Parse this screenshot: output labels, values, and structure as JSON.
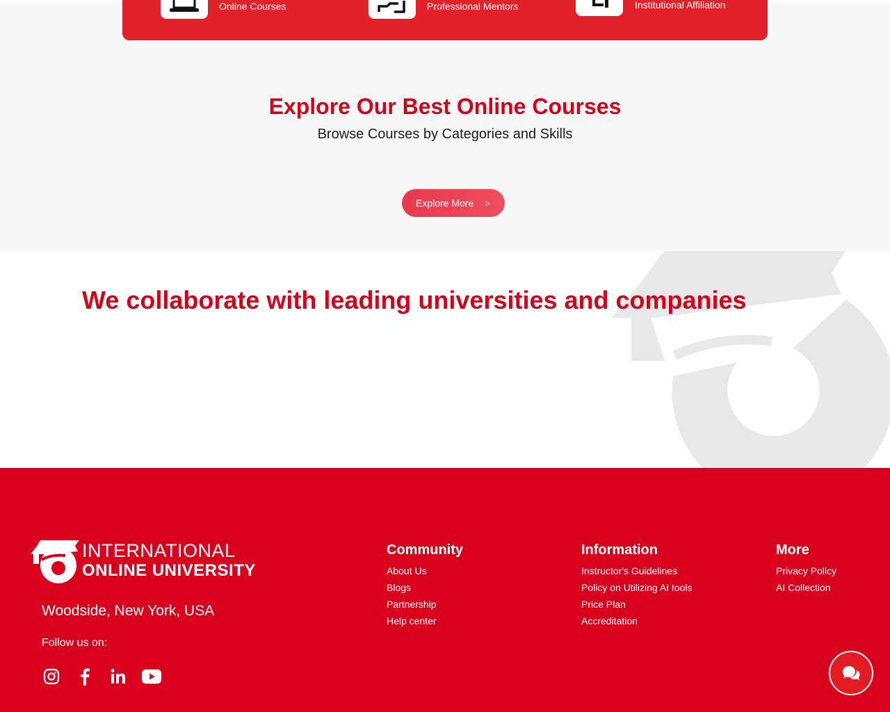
{
  "features": [
    {
      "label": "Online Courses",
      "icon": "laptop-icon"
    },
    {
      "label": "Professional Mentors",
      "icon": "mentor-icon"
    },
    {
      "label": "Institutional Affiliation",
      "icon": "institution-icon"
    }
  ],
  "explore": {
    "title": "Explore Our Best Online Courses",
    "subtitle": "Browse Courses by Categories and Skills",
    "button_label": "Explore More",
    "button_chevron": ">"
  },
  "collab": {
    "title": "We collaborate with leading universities and companies"
  },
  "footer": {
    "logo_line1": "INTERNATIONAL",
    "logo_line2": "ONLINE UNIVERSITY",
    "address": "Woodside, New York, USA",
    "follow_label": "Follow us on:",
    "socials": [
      "instagram-icon",
      "facebook-icon",
      "linkedin-icon",
      "youtube-icon"
    ],
    "columns": {
      "community": {
        "title": "Community",
        "links": [
          "About Us",
          "Blogs",
          "Partnership",
          "Help center"
        ]
      },
      "information": {
        "title": "Information",
        "links": [
          "Instructor's Guidelines",
          "Policy on Utilizing AI tools",
          "Price Plan",
          "Accreditation"
        ]
      },
      "more": {
        "title": "More",
        "links": [
          "Privacy Policy",
          "AI Collection"
        ]
      }
    }
  },
  "colors": {
    "brand_red": "#d8001c",
    "banner_red": "#e32128",
    "title_red": "#d0021b",
    "watermark_gray": "#e8e8e8"
  }
}
